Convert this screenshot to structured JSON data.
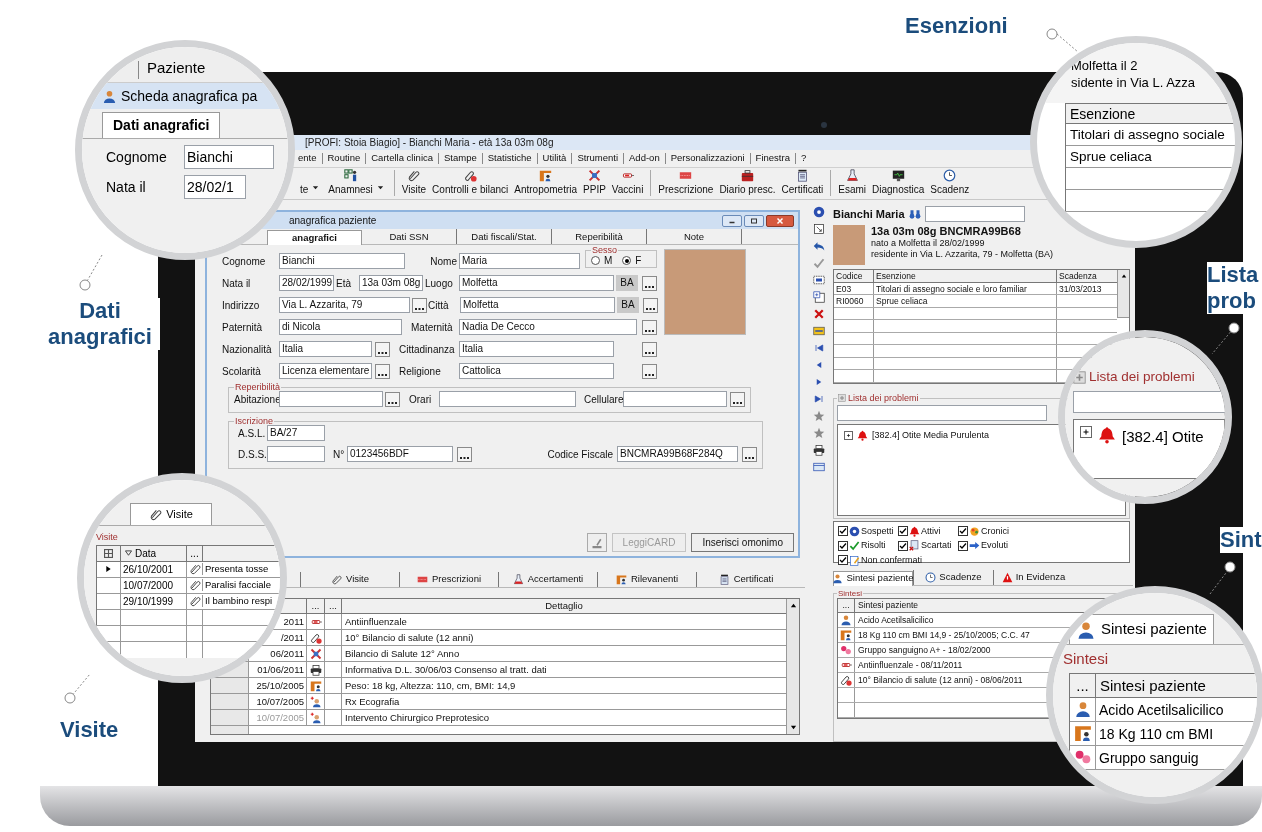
{
  "callouts": {
    "dati_anagrafici": {
      "caption": "Dati anagrafici",
      "menu": "Paziente",
      "window_title": "Scheda anagrafica pa",
      "tab": "Dati anagrafici",
      "fields": [
        {
          "label": "Cognome",
          "value": "Bianchi"
        },
        {
          "label": "Nata il",
          "value": "28/02/1"
        }
      ]
    },
    "esenzioni": {
      "caption": "Esenzioni",
      "lines": [
        "Molfetta il 2",
        "sidente in Via L. Azza"
      ],
      "column": "Esenzione",
      "rows": [
        "Titolari di assegno sociale",
        "Sprue celiaca"
      ]
    },
    "lista": {
      "caption_lines": [
        "Lista",
        "prob"
      ],
      "legend": "Lista dei problemi",
      "item": {
        "label": "[382.4] Otite",
        "expanded": false
      }
    },
    "sintesi": {
      "caption": "Sint",
      "tab": "Sintesi paziente",
      "legend": "Sintesi",
      "columns": [
        "...",
        "Sintesi paziente"
      ],
      "rows": [
        "Acido Acetilsalicilico",
        "18 Kg 110 cm BMI",
        "Gruppo sanguig"
      ]
    },
    "visite": {
      "caption": "Visite",
      "tab": "Visite",
      "legend": "Visite",
      "columns": [
        "Data",
        "..."
      ],
      "rows": [
        {
          "date": "26/10/2001",
          "text": "Presenta tosse",
          "selected": true
        },
        {
          "date": "10/07/2000",
          "text": "Paralisi facciale",
          "selected": false
        },
        {
          "date": "29/10/1999",
          "text": "Il bambino respi",
          "selected": false
        }
      ]
    }
  },
  "app": {
    "title": "[PROFI: Stoia Biagio] - Bianchi Maria - età 13a 03m 08g",
    "menu": [
      "ente",
      "Routine",
      "Cartella clinica",
      "Stampe",
      "Statistiche",
      "Utilità",
      "Strumenti",
      "Add-on",
      "Personalizzazioni",
      "Finestra",
      "?"
    ],
    "toolbar": [
      {
        "label": "te",
        "dropdown": true
      },
      {
        "label": "Anamnesi",
        "dropdown": true
      },
      {
        "label": "Visite",
        "dropdown": false
      },
      {
        "label": "Controlli e bilanci",
        "dropdown": false
      },
      {
        "label": "Antropometria",
        "dropdown": false
      },
      {
        "label": "PPIP",
        "dropdown": false
      },
      {
        "label": "Vaccini",
        "dropdown": false
      },
      {
        "label": "Prescrizione",
        "dropdown": false
      },
      {
        "label": "Diario presc.",
        "dropdown": false
      },
      {
        "label": "Certificati",
        "dropdown": false
      },
      {
        "label": "Esami",
        "dropdown": false
      },
      {
        "label": "Diagnostica",
        "dropdown": false
      },
      {
        "label": "Scadenz",
        "dropdown": false
      }
    ]
  },
  "patient_form": {
    "title": "anagrafica paziente",
    "tabs": [
      {
        "label": "anagrafici",
        "selected": true
      },
      {
        "label": "Dati SSN",
        "selected": false
      },
      {
        "label": "Dati fiscali/Stat.",
        "selected": false
      },
      {
        "label": "Reperibilità",
        "selected": false
      },
      {
        "label": "Note",
        "selected": false
      }
    ],
    "cognome": {
      "label": "Cognome",
      "value": "Bianchi"
    },
    "nome": {
      "label": "Nome",
      "value": "Maria"
    },
    "sesso": {
      "label": "Sesso",
      "options": [
        {
          "label": "M",
          "selected": false
        },
        {
          "label": "F",
          "selected": true
        }
      ]
    },
    "nata_il": {
      "label": "Nata il",
      "value": "28/02/1999"
    },
    "eta": {
      "label": "Età",
      "value": "13a 03m 08g"
    },
    "luogo": {
      "label": "Luogo",
      "value": "Molfetta",
      "province": "BA"
    },
    "indirizzo": {
      "label": "Indirizzo",
      "value": "Via L. Azzarita, 79"
    },
    "citta": {
      "label": "Città",
      "value": "Molfetta",
      "province": "BA"
    },
    "paternita": {
      "label": "Paternità",
      "value": "di Nicola"
    },
    "maternita": {
      "label": "Maternità",
      "value": "Nadia De Cecco"
    },
    "nazionalita": {
      "label": "Nazionalità",
      "value": "Italia"
    },
    "cittadinanza": {
      "label": "Cittadinanza",
      "value": "Italia"
    },
    "scolarita": {
      "label": "Scolarità",
      "value": "Licenza elementare"
    },
    "religione": {
      "label": "Religione",
      "value": "Cattolica"
    },
    "reperibilita": {
      "legend": "Reperibilità",
      "fields": [
        {
          "label": "Abitazione"
        },
        {
          "label": "Orari"
        },
        {
          "label": "Cellulare"
        }
      ]
    },
    "iscrizione": {
      "legend": "Iscrizione",
      "asl": {
        "label": "A.S.L.",
        "value": "BA/27"
      },
      "dss": {
        "label": "D.S.S."
      },
      "numero": {
        "label": "N°",
        "value": "0123456BDF"
      },
      "codice_fiscale": {
        "label": "Codice Fiscale",
        "value": "BNCMRA99B68F284Q"
      }
    },
    "buttons": [
      {
        "label": "LeggiCARD",
        "disabled": true
      },
      {
        "label": "Inserisci omonimo",
        "disabled": false
      }
    ]
  },
  "bottom_tabs": [
    {
      "label": "Visite",
      "selected": false
    },
    {
      "label": "Prescrizioni",
      "selected": false
    },
    {
      "label": "Accertamenti",
      "selected": false
    },
    {
      "label": "Rilevanenti",
      "selected": false
    },
    {
      "label": "Certificati",
      "selected": false
    }
  ],
  "detail_grid": {
    "columns": [
      "...",
      "...",
      "Dettaglio"
    ],
    "rows": [
      {
        "date": "2011",
        "detail": "Antiinfluenzale",
        "dimmed": false
      },
      {
        "date": "/2011",
        "detail": "10° Bilancio di salute (12 anni)",
        "dimmed": false
      },
      {
        "date": "06/2011",
        "detail": "Bilancio di Salute 12° Anno",
        "dimmed": false
      },
      {
        "date": "01/06/2011",
        "detail": "Informativa D.L. 30/06/03 Consenso al tratt. dati",
        "dimmed": false
      },
      {
        "date": "25/10/2005",
        "detail": "Peso: 18 kg, Altezza: 110, cm, BMI: 14,9",
        "dimmed": false
      },
      {
        "date": "10/07/2005",
        "detail": "Rx Ecografia",
        "dimmed": false
      },
      {
        "date": "10/07/2005",
        "detail": "Intervento Chirurgico Preprotesico",
        "dimmed": true
      }
    ]
  },
  "patient_summary": {
    "name": "Bianchi Maria",
    "age_code": "13a 03m 08g  BNCMRA99B68",
    "birth": "nato a Molfetta il 28/02/1999",
    "residence": "residente in Via L. Azzarita, 79 - Molfetta (BA)"
  },
  "esenzioni": {
    "columns": [
      "Codice",
      "Esenzione",
      "Scadenza"
    ],
    "rows": [
      {
        "codice": "E03",
        "esenzione": "Titolari di assegno sociale e loro familiar",
        "scadenza": "31/03/2013"
      },
      {
        "codice": "RI0060",
        "esenzione": "Sprue celiaca"
      }
    ]
  },
  "problemi": {
    "legend": "Lista dei problemi",
    "items": [
      {
        "label": "[382.4] Otite Media Purulenta",
        "expanded": false
      }
    ]
  },
  "filters": [
    {
      "label": "Sospetti",
      "checked": true
    },
    {
      "label": "Attivi",
      "checked": true
    },
    {
      "label": "Cronici",
      "checked": true
    },
    {
      "label": "Risolti",
      "checked": true
    },
    {
      "label": "Scartati",
      "checked": true
    },
    {
      "label": "Evoluti",
      "checked": true
    },
    {
      "label": "Non confermati",
      "checked": true
    }
  ],
  "sintesi_tabs": [
    {
      "label": "Sintesi paziente",
      "selected": true
    },
    {
      "label": "Scadenze",
      "selected": false
    },
    {
      "label": "In Evidenza",
      "selected": false
    }
  ],
  "sintesi": {
    "legend": "Sintesi",
    "columns": [
      "...",
      "Sintesi paziente"
    ],
    "rows": [
      "Acido Acetilsalicilico",
      "18 Kg 110 cm BMI 14,9 - 25/10/2005; C.C. 47",
      "Gruppo sanguigno A+ - 18/02/2000",
      "Antiinfluenzale - 08/11/2011",
      "10° Bilancio di salute (12 anni) - 08/06/2011"
    ]
  }
}
